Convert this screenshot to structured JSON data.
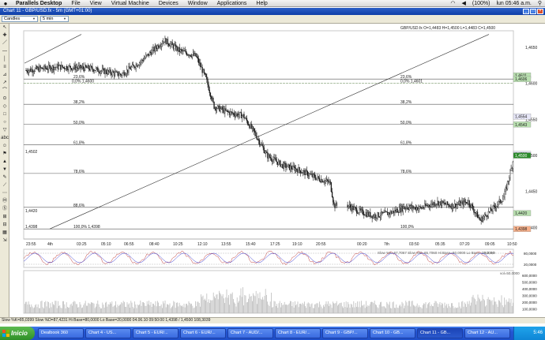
{
  "mac": {
    "apple": "",
    "menus": [
      "Parallels Desktop",
      "File",
      "View",
      "Virtual Machine",
      "Devices",
      "Window",
      "Applications",
      "Help"
    ],
    "battery": "(100%)",
    "clock": "lun 05:46 a.m."
  },
  "window": {
    "title": "Chart 11 - GBP/USD.fx - 5m (GMT+01:00)"
  },
  "toolbar": {
    "style": "Candles",
    "timeframe": "5 min"
  },
  "tools": [
    "↖",
    "✚",
    "／",
    "—",
    "│",
    "≡",
    "⊿",
    "↗",
    "⌒",
    "⊙",
    "◇",
    "□",
    "○",
    "▽",
    "abc",
    "☺",
    "⚑",
    "▲",
    "▼",
    "✎",
    "⟋",
    "⋯",
    "Ⓜ",
    "Ⓢ",
    "⊞",
    "⊟",
    "▦",
    "⇲"
  ],
  "chart": {
    "header": "GBP/USD.fx O=1,4483 H=1,4500 L=1,4483 C=1,4500",
    "fib_levels": [
      {
        "label_left": "0,0% 1,4600",
        "label_right": "0,0% 1,4601",
        "value": 1.46
      },
      {
        "label_left": "23,6%",
        "label_right": "23,6%",
        "value": 1.4606
      },
      {
        "label_left": "38,2%",
        "label_right": "38,2%",
        "value": 1.4571
      },
      {
        "label_left": "50,0%",
        "label_right": "50,0%",
        "value": 1.4543
      },
      {
        "label_left": "61,8%",
        "label_right": "61,8%",
        "value": 1.4515
      },
      {
        "label_left": "78,6%",
        "label_right": "78,6%",
        "value": 1.4475
      },
      {
        "label_left": "88,6%",
        "label_right": "88,6%",
        "value": 1.4428
      },
      {
        "label_left": "100,0% 1,4398",
        "label_right": "100,0%",
        "value": 1.4398
      }
    ],
    "left_price_labels": [
      "1,4502",
      "1,4420",
      "1,4398"
    ],
    "y_ticks": [
      "1,4650",
      "1,4600",
      "1,4550",
      "1,4500",
      "1,4450",
      "1,4400"
    ],
    "price_tags": [
      {
        "text": "1,4611",
        "color": "#b9e0b0",
        "value": 1.4611
      },
      {
        "text": "1,4606",
        "color": "#b9e0b0",
        "value": 1.4606
      },
      {
        "text": "1,4554",
        "color": "#e6e6f7",
        "value": 1.4554
      },
      {
        "text": "1,4543",
        "color": "#b9e0b0",
        "value": 1.4543
      },
      {
        "text": "1,4502",
        "color": "#e6e6f7",
        "value": 1.4502
      },
      {
        "text": "1,4500",
        "color": "#2a8a2a",
        "value": 1.45
      },
      {
        "text": "1,4420",
        "color": "#b9e0b0",
        "value": 1.442
      },
      {
        "text": "1,4398",
        "color": "#f7b08a",
        "value": 1.4398
      }
    ],
    "x_ticks": [
      "23:55",
      "4th",
      "03:25",
      "05:10",
      "06:55",
      "08:40",
      "10:25",
      "12:10",
      "13:55",
      "15:40",
      "17:25",
      "19:10",
      "20:55",
      "00:20",
      "7th",
      "03:50",
      "05:35",
      "07:20",
      "09:05",
      "10:50"
    ],
    "stoch_label": "Slow %K=67,7067  Slow %D=65,7060  Hi Base=80,0000  Lo Base=20,0000",
    "stoch_ticks": [
      "80,0000",
      "20,0000"
    ],
    "vol_label": "vol=50,0000",
    "vol_ticks": [
      "600,0000",
      "500,0000",
      "400,0000",
      "300,0000",
      "200,0000",
      "100,0000"
    ],
    "stoch_mini": "8,3,3,0"
  },
  "status": "Slow %K=85,0399  Slow %D=87,4231  Hi Base=80,0000  Lo Base=20,0000    04.06.10 09:50:00  1,4398 / 1,4500  108,3039",
  "taskbar": {
    "start": "Inicio",
    "tasks": [
      "Dealbook 360",
      "Chart 4 - US...",
      "Chart 5 - EUR/...",
      "Chart 6 - EUR/...",
      "Chart 7 - AUD/...",
      "Chart 8 - EUR/...",
      "Chart 9 - GBP/...",
      "Chart 10 - GB...",
      "Chart 11 - GB...",
      "Chart 12 - AU..."
    ],
    "clock": "5:46"
  },
  "colors": {
    "candle": "#1a1a1a",
    "fib": "#555555",
    "fib_top": "#7a9a6a",
    "stoch_k": "#c04040",
    "stoch_d": "#3a3ad0",
    "volume": "#bdbdbd"
  }
}
